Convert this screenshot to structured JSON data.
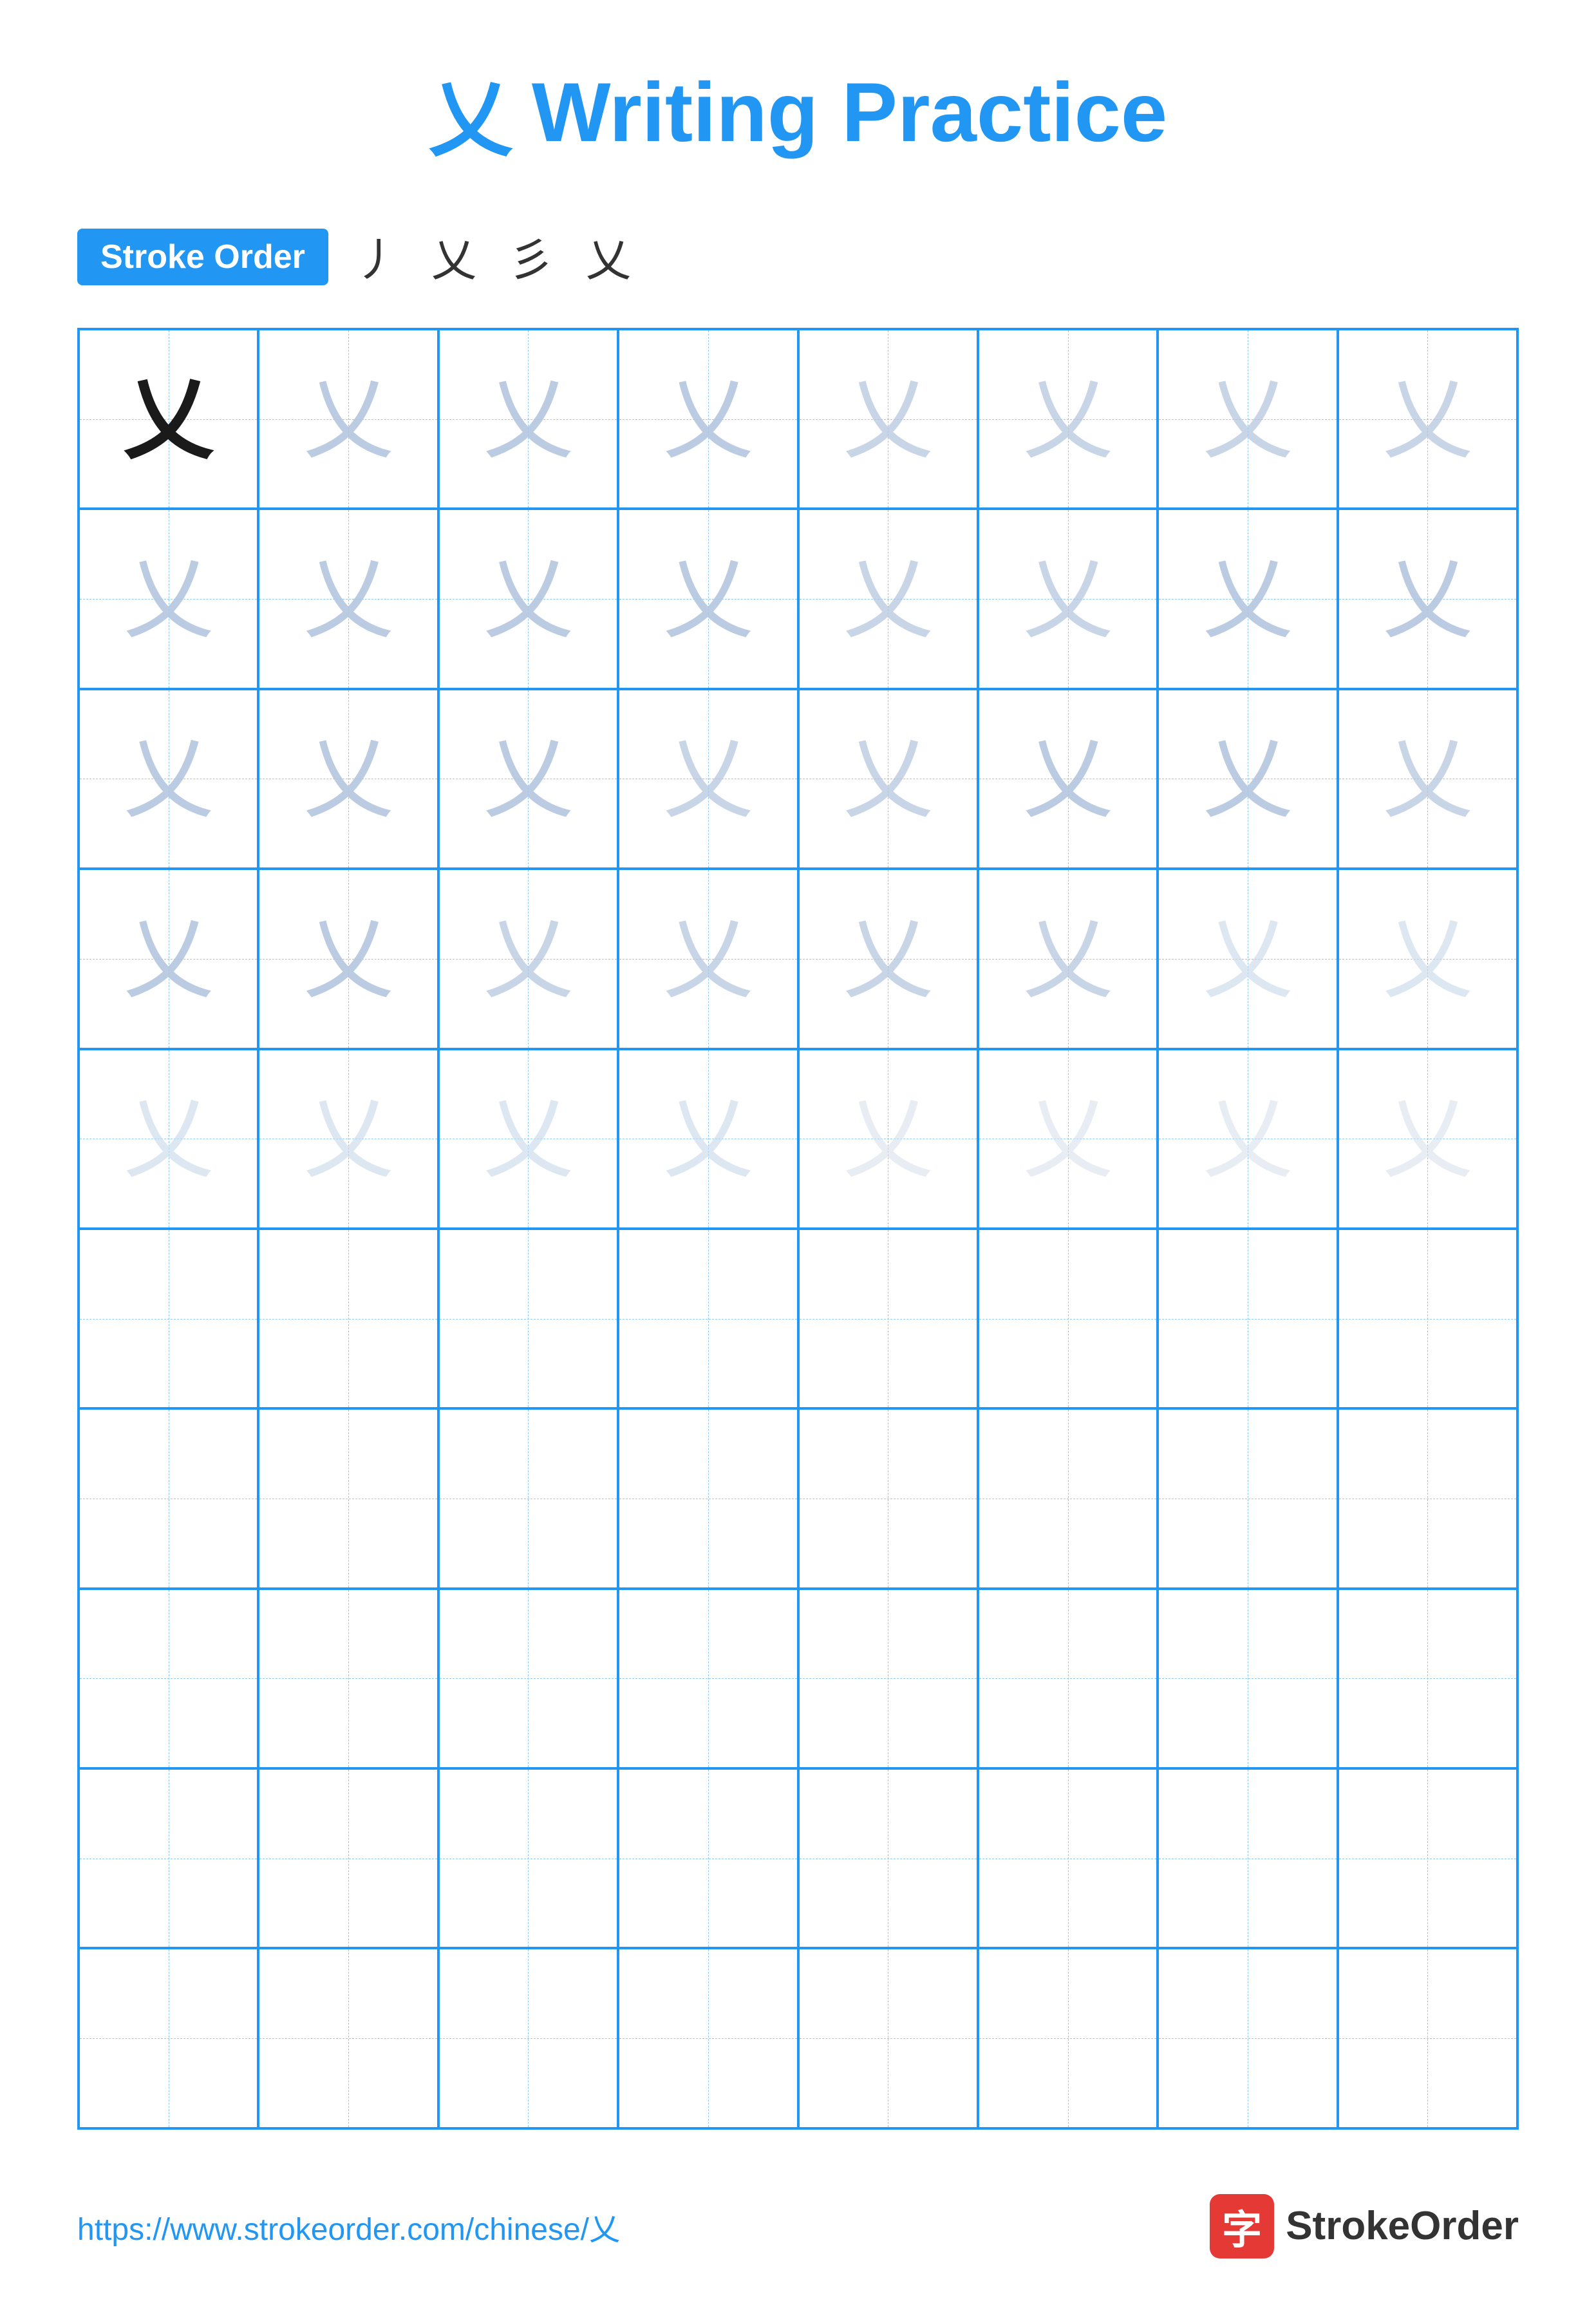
{
  "title": {
    "char": "乂",
    "text": "Writing Practice"
  },
  "stroke_order": {
    "badge_label": "Stroke Order",
    "steps": [
      "丿",
      "乂",
      "彡",
      "乂"
    ]
  },
  "grid": {
    "rows": 10,
    "cols": 8,
    "character": "乂",
    "filled_rows": 5,
    "row_styles": [
      [
        "dark",
        "light1",
        "light1",
        "light1",
        "light2",
        "light2",
        "light2",
        "light2"
      ],
      [
        "light1",
        "light1",
        "light1",
        "light1",
        "light2",
        "light2",
        "light2",
        "light2"
      ],
      [
        "light1",
        "light1",
        "light1",
        "light1",
        "light2",
        "light2",
        "light2",
        "light2"
      ],
      [
        "light1",
        "light1",
        "light1",
        "light1",
        "light2",
        "light2",
        "light3",
        "light3"
      ],
      [
        "light3",
        "light3",
        "light3",
        "light3",
        "light4",
        "light4",
        "light4",
        "light4"
      ]
    ]
  },
  "footer": {
    "url": "https://www.strokeorder.com/chinese/乂",
    "logo_text": "StrokeOrder",
    "logo_icon": "字"
  },
  "colors": {
    "blue": "#2196F3",
    "light_blue": "#90CAF9",
    "dark_text": "#1a1a1a",
    "char_light": "#b0c4de",
    "badge_bg": "#2196F3",
    "badge_text": "#ffffff"
  }
}
